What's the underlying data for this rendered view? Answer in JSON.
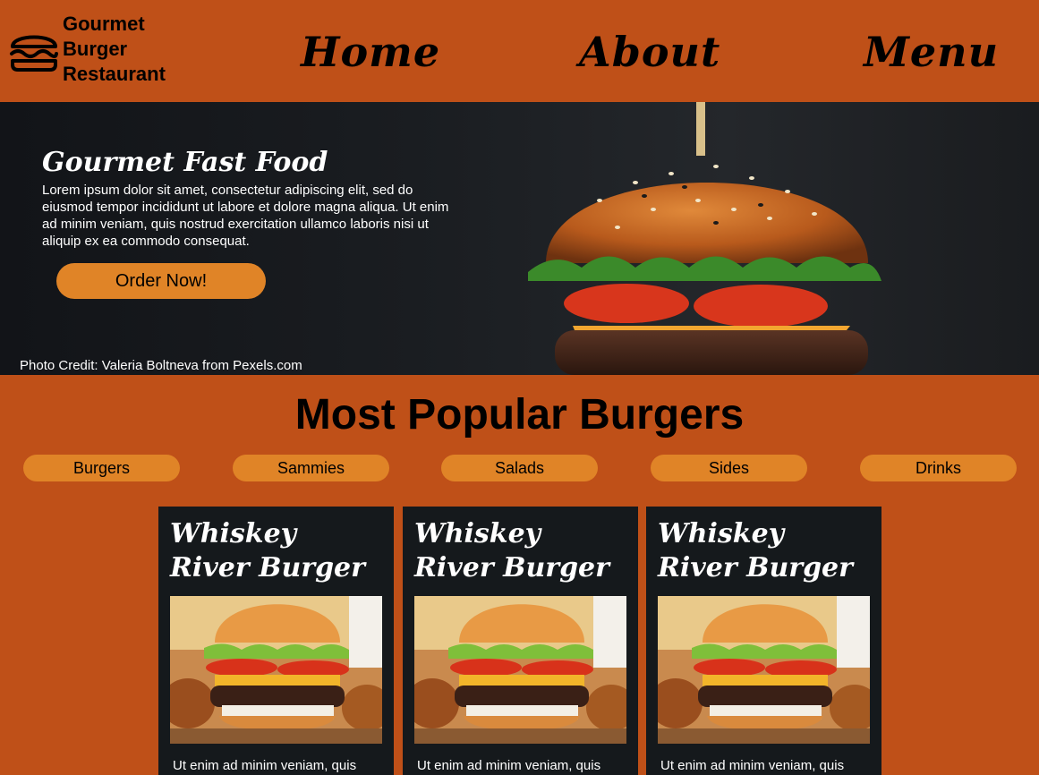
{
  "header": {
    "brand_lines": [
      "Gourmet",
      "Burger",
      "Restaurant"
    ],
    "logo_icon": "burger-icon",
    "nav": [
      {
        "label": "Home"
      },
      {
        "label": "About"
      },
      {
        "label": "Menu"
      }
    ]
  },
  "hero": {
    "title": "Gourmet Fast Food",
    "text": "Lorem ipsum dolor sit amet, consectetur adipiscing elit, sed do eiusmod tempor incididunt ut labore et dolore magna aliqua. Ut enim ad minim veniam, quis nostrud exercitation ullamco laboris nisi ut aliquip ex ea commodo consequat.",
    "cta_label": "Order Now!",
    "photo_credit": "Photo Credit: Valeria Boltneva from Pexels.com"
  },
  "popular": {
    "title": "Most Popular Burgers",
    "categories": [
      {
        "label": "Burgers"
      },
      {
        "label": "Sammies"
      },
      {
        "label": "Salads"
      },
      {
        "label": "Sides"
      },
      {
        "label": "Drinks"
      }
    ],
    "cards": [
      {
        "title": "Whiskey River Burger",
        "text": "Ut enim ad minim veniam, quis"
      },
      {
        "title": "Whiskey River Burger",
        "text": "Ut enim ad minim veniam, quis"
      },
      {
        "title": "Whiskey River Burger",
        "text": "Ut enim ad minim veniam, quis"
      }
    ]
  },
  "colors": {
    "background": "#bf5018",
    "accent": "#e08427",
    "card_bg": "#15191c",
    "text_dark": "#000000",
    "text_light": "#ffffff"
  }
}
